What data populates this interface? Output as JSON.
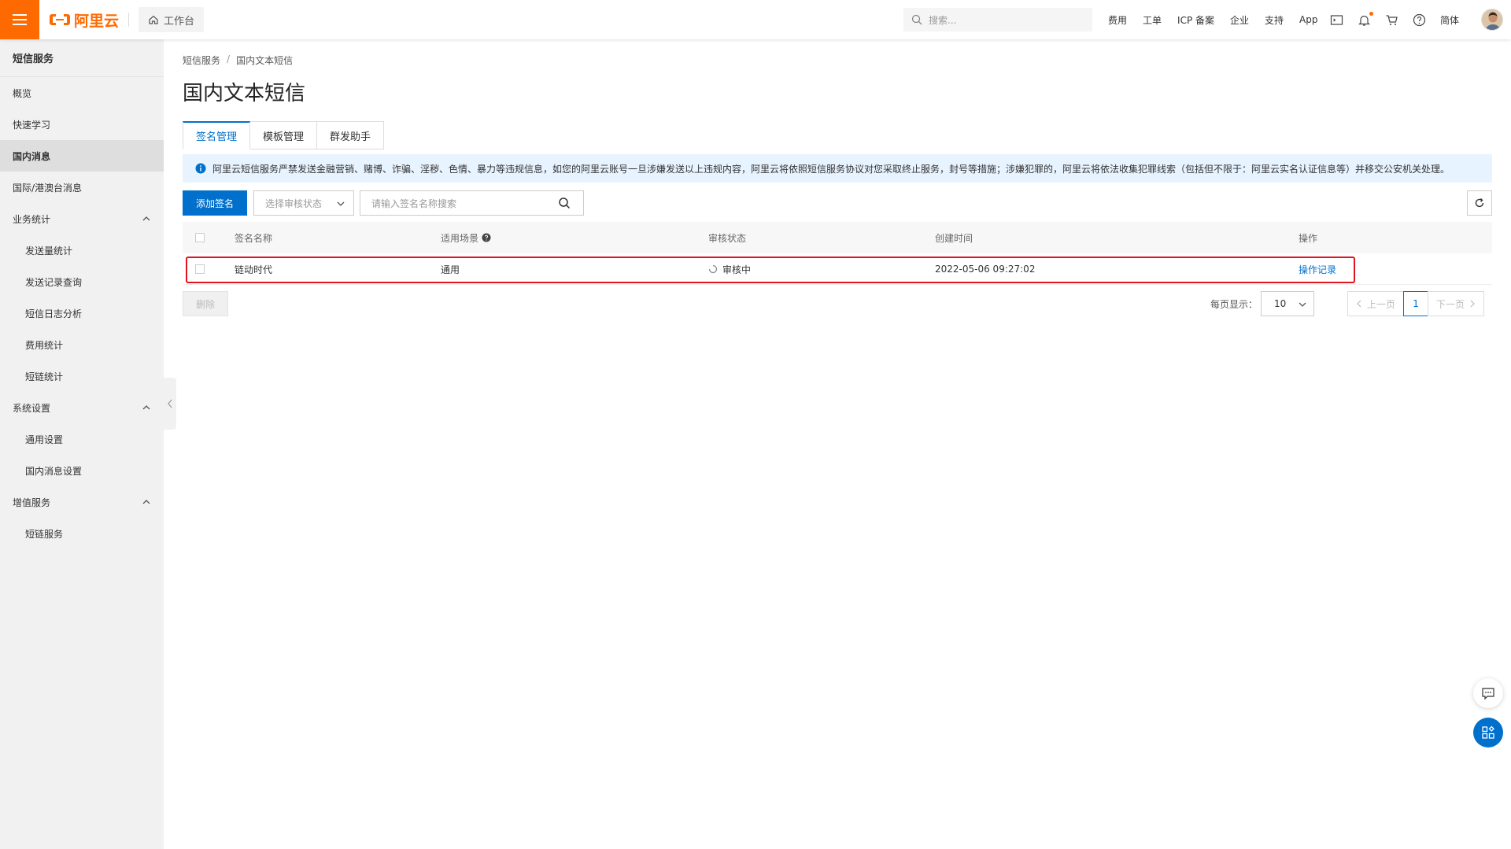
{
  "topbar": {
    "logo_text": "阿里云",
    "workbench_label": "工作台",
    "search_placeholder": "搜索...",
    "links": [
      "费用",
      "工单",
      "ICP 备案",
      "企业",
      "支持",
      "App"
    ],
    "lang_label": "简体"
  },
  "sidebar": {
    "title": "短信服务",
    "items": [
      {
        "label": "概览",
        "level": 1
      },
      {
        "label": "快速学习",
        "level": 1
      },
      {
        "label": "国内消息",
        "level": 1,
        "active": true
      },
      {
        "label": "国际/港澳台消息",
        "level": 1
      },
      {
        "label": "业务统计",
        "level": 1,
        "expanded": true
      },
      {
        "label": "发送量统计",
        "level": 2
      },
      {
        "label": "发送记录查询",
        "level": 2
      },
      {
        "label": "短信日志分析",
        "level": 2
      },
      {
        "label": "费用统计",
        "level": 2
      },
      {
        "label": "短链统计",
        "level": 2
      },
      {
        "label": "系统设置",
        "level": 1,
        "expanded": true
      },
      {
        "label": "通用设置",
        "level": 2
      },
      {
        "label": "国内消息设置",
        "level": 2
      },
      {
        "label": "增值服务",
        "level": 1,
        "expanded": true
      },
      {
        "label": "短链服务",
        "level": 2
      }
    ]
  },
  "breadcrumb": [
    "短信服务",
    "国内文本短信"
  ],
  "breadcrumb_sep": "/",
  "page_title": "国内文本短信",
  "tabs": [
    {
      "label": "签名管理",
      "active": true
    },
    {
      "label": "模板管理"
    },
    {
      "label": "群发助手"
    }
  ],
  "notice": "阿里云短信服务严禁发送金融营销、赌博、诈骗、淫秽、色情、暴力等违规信息，如您的阿里云账号一旦涉嫌发送以上违规内容，阿里云将依照短信服务协议对您采取终止服务，封号等措施；涉嫌犯罪的，阿里云将依法收集犯罪线索（包括但不限于：阿里云实名认证信息等）并移交公安机关处理。",
  "toolbar": {
    "add_label": "添加签名",
    "status_select_placeholder": "选择审核状态",
    "search_placeholder": "请输入签名名称搜索"
  },
  "table": {
    "columns": [
      "签名名称",
      "适用场景",
      "审核状态",
      "创建时间",
      "操作"
    ],
    "rows": [
      {
        "name": "链动时代",
        "scene": "通用",
        "status": "审核中",
        "created": "2022-05-06 09:27:02",
        "action": "操作记录"
      }
    ]
  },
  "footer": {
    "delete_label": "删除",
    "per_page_label": "每页显示：",
    "per_page_value": "10",
    "prev_label": "上一页",
    "next_label": "下一页",
    "current_page": "1"
  },
  "colors": {
    "accent": "#0070cc",
    "brand": "#ff6a00",
    "highlight": "#e0141e"
  }
}
